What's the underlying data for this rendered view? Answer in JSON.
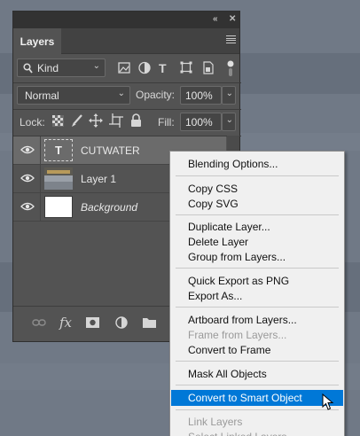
{
  "panel": {
    "tab_label": "Layers",
    "collapse_icon": "double-chevron-icon",
    "close_icon": "close-icon",
    "filter_label": "Kind",
    "blend_mode": "Normal",
    "opacity_label": "Opacity:",
    "opacity_value": "100%",
    "lock_label": "Lock:",
    "fill_label": "Fill:",
    "fill_value": "100%"
  },
  "layers": [
    {
      "name": "CUTWATER",
      "type": "text",
      "selected": true
    },
    {
      "name": "Layer 1",
      "type": "image",
      "selected": false
    },
    {
      "name": "Background",
      "type": "background",
      "selected": false
    }
  ],
  "menu": {
    "items": [
      "Blending Options...",
      "Copy CSS",
      "Copy SVG",
      "Duplicate Layer...",
      "Delete Layer",
      "Group from Layers...",
      "Quick Export as PNG",
      "Export As...",
      "Artboard from Layers...",
      "Frame from Layers...",
      "Convert to Frame",
      "Mask All Objects",
      "Convert to Smart Object",
      "Link Layers",
      "Select Linked Layers"
    ]
  },
  "colors": {
    "highlight": "#0078d7",
    "panel_bg": "#535353",
    "menu_bg": "#f0f0f0"
  }
}
